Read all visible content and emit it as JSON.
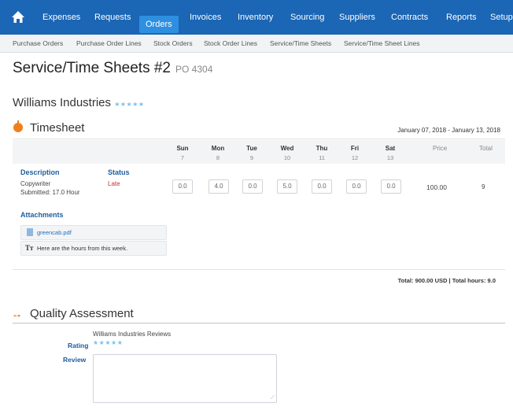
{
  "nav": {
    "items": [
      "Expenses",
      "Requests",
      "Orders",
      "Invoices",
      "Inventory",
      "Sourcing",
      "Suppliers",
      "Contracts",
      "Reports",
      "Setup"
    ],
    "active": "Orders"
  },
  "subnav": {
    "items": [
      "Purchase Orders",
      "Purchase Order Lines",
      "Stock Orders",
      "Stock Order Lines",
      "Service/Time Sheets",
      "Service/Time Sheet Lines"
    ]
  },
  "page": {
    "title": "Service/Time Sheets #2",
    "po": "PO 4304"
  },
  "company": {
    "name": "Williams Industries",
    "rating_stars": "★★★★★"
  },
  "timesheet": {
    "title": "Timesheet",
    "date_range": "January 07, 2018 - January 13, 2018",
    "days": [
      {
        "name": "Sun",
        "date": "7"
      },
      {
        "name": "Mon",
        "date": "8"
      },
      {
        "name": "Tue",
        "date": "9"
      },
      {
        "name": "Wed",
        "date": "10"
      },
      {
        "name": "Thu",
        "date": "11"
      },
      {
        "name": "Fri",
        "date": "12"
      },
      {
        "name": "Sat",
        "date": "13"
      }
    ],
    "price_label": "Price",
    "total_label": "Total",
    "description_label": "Description",
    "status_label": "Status",
    "line": {
      "description": "Copywriter",
      "submitted": "Submitted: 17.0 Hour",
      "status": "Late",
      "hours": [
        "0.0",
        "4.0",
        "0.0",
        "5.0",
        "0.0",
        "0.0",
        "0.0"
      ],
      "price": "100.00",
      "total": "9"
    },
    "attachments_label": "Attachments",
    "attachment_file": "greencab.pdf",
    "attachment_note": "Here are the hours from this week.",
    "note_icon_text": "Tт",
    "totals": "Total: 900.00 USD  |  Total hours: 9.0"
  },
  "quality": {
    "title": "Quality Assessment",
    "reviews_title": "Williams Industries Reviews",
    "rating_label": "Rating",
    "rating_stars": "★★★★★",
    "review_label": "Review",
    "review_value": ""
  },
  "colors": {
    "nav_bg": "#1b66b5",
    "nav_active": "#2e8fe0",
    "accent_orange": "#f07e1d",
    "late_red": "#d0302b",
    "label_blue": "#1e5d9e"
  }
}
